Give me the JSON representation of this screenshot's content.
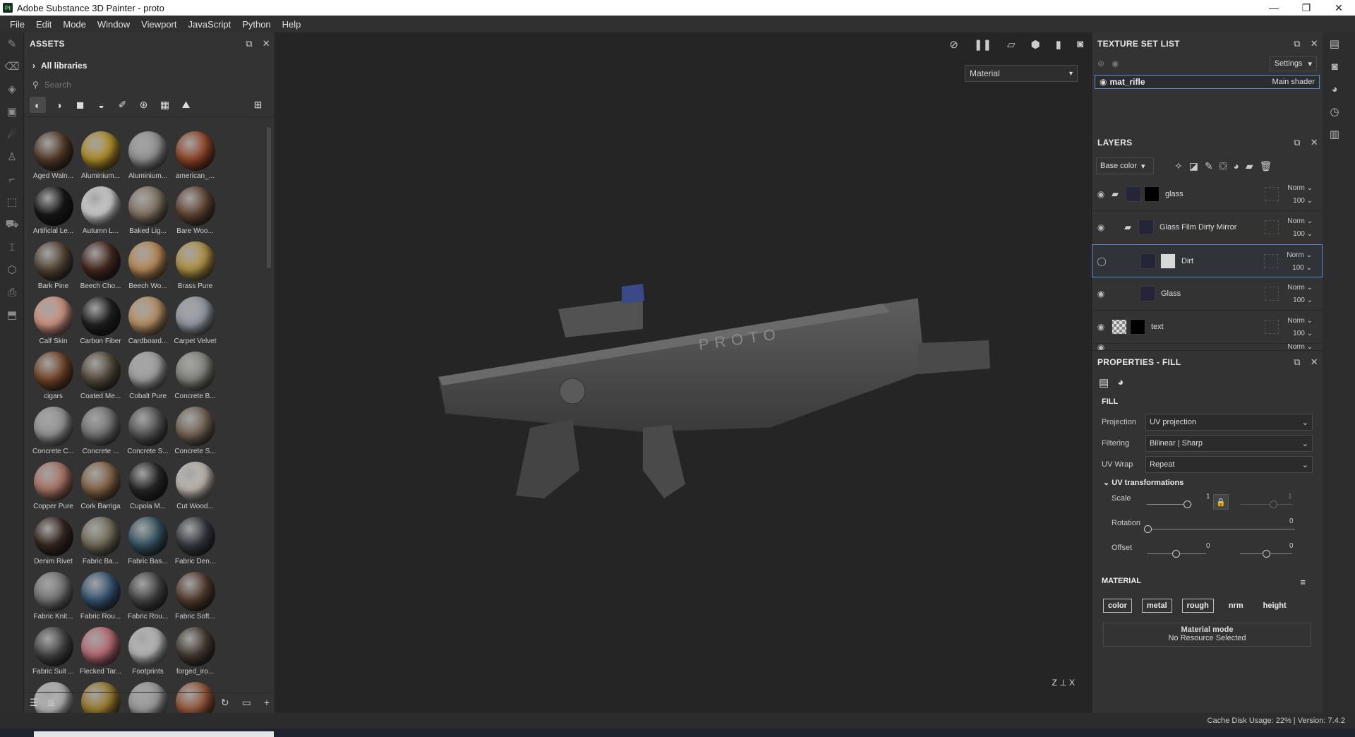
{
  "window": {
    "title": "Adobe Substance 3D Painter - proto",
    "app_icon": "Pt",
    "controls": [
      "—",
      "❐",
      "✕"
    ]
  },
  "menu": [
    "File",
    "Edit",
    "Mode",
    "Window",
    "Viewport",
    "JavaScript",
    "Python",
    "Help"
  ],
  "assets": {
    "title": "ASSETS",
    "library": "All libraries",
    "search_placeholder": "Search",
    "items": [
      {
        "label": "Aged Waln...",
        "color": "#5a3f2c"
      },
      {
        "label": "Aluminium...",
        "color": "#b8942c"
      },
      {
        "label": "Aluminium...",
        "color": "#9a9a9a"
      },
      {
        "label": "american_...",
        "color": "#9a4a2c"
      },
      {
        "label": "Artificial Le...",
        "color": "#1a1a1a"
      },
      {
        "label": "Autumn L...",
        "color": "#d8d8d8"
      },
      {
        "label": "Baked Lig...",
        "color": "#8a7a68"
      },
      {
        "label": "Bare Woo...",
        "color": "#6a4a38"
      },
      {
        "label": "Bark Pine",
        "color": "#5a4a3a"
      },
      {
        "label": "Beech Cho...",
        "color": "#4a2c22"
      },
      {
        "label": "Beech Wo...",
        "color": "#c0905a"
      },
      {
        "label": "Brass Pure",
        "color": "#b89a48"
      },
      {
        "label": "Calf Skin",
        "color": "#d89a88"
      },
      {
        "label": "Carbon Fiber",
        "color": "#222222"
      },
      {
        "label": "Cardboard...",
        "color": "#c0986a"
      },
      {
        "label": "Carpet Velvet",
        "color": "#9aa0aa"
      },
      {
        "label": "cigars",
        "color": "#7a4a2c"
      },
      {
        "label": "Coated Me...",
        "color": "#5a5040"
      },
      {
        "label": "Cobalt Pure",
        "color": "#a8a8a8"
      },
      {
        "label": "Concrete B...",
        "color": "#8a8a82"
      },
      {
        "label": "Concrete C...",
        "color": "#9a9a9a"
      },
      {
        "label": "Concrete ...",
        "color": "#7a7a7a"
      },
      {
        "label": "Concrete S...",
        "color": "#5a5a5a"
      },
      {
        "label": "Concrete S...",
        "color": "#7a6a5a"
      },
      {
        "label": "Copper Pure",
        "color": "#b07a6a"
      },
      {
        "label": "Cork Barriga",
        "color": "#8a6a4a"
      },
      {
        "label": "Cupola M...",
        "color": "#2a2a2a"
      },
      {
        "label": "Cut Wood...",
        "color": "#c8c0b8"
      },
      {
        "label": "Denim Rivet",
        "color": "#3a2a22"
      },
      {
        "label": "Fabric Ba...",
        "color": "#7a7260"
      },
      {
        "label": "Fabric Bas...",
        "color": "#3a5a6a"
      },
      {
        "label": "Fabric Den...",
        "color": "#3a3e44"
      },
      {
        "label": "Fabric Knit...",
        "color": "#7a7a7a"
      },
      {
        "label": "Fabric Rou...",
        "color": "#3a5a7a"
      },
      {
        "label": "Fabric Rou...",
        "color": "#4a4a4a"
      },
      {
        "label": "Fabric Soft...",
        "color": "#5a4034"
      },
      {
        "label": "Fabric Suit ...",
        "color": "#4a4a4a"
      },
      {
        "label": "Flecked Tar...",
        "color": "#c0707a"
      },
      {
        "label": "Footprints",
        "color": "#c0c0c0"
      },
      {
        "label": "forged_iro...",
        "color": "#4a4036"
      },
      {
        "label": "",
        "color": "#bbbbbb"
      },
      {
        "label": "",
        "color": "#a08030"
      },
      {
        "label": "",
        "color": "#a0a0a0"
      },
      {
        "label": "",
        "color": "#9a5a3a"
      }
    ]
  },
  "viewport": {
    "display_mode": "Material",
    "axis_label": "Z ⊥ X"
  },
  "texture_set_list": {
    "title": "TEXTURE SET LIST",
    "settings_label": "Settings",
    "item": {
      "name": "mat_rifle",
      "shader": "Main shader"
    }
  },
  "layers": {
    "title": "LAYERS",
    "channel": "Base color",
    "items": [
      {
        "name": "glass",
        "blend": "Norm",
        "opacity": "100"
      },
      {
        "name": "Glass Film Dirty Mirror",
        "blend": "Norm",
        "opacity": "100"
      },
      {
        "name": "Dirt",
        "blend": "Norm",
        "opacity": "100"
      },
      {
        "name": "Glass",
        "blend": "Norm",
        "opacity": "100"
      },
      {
        "name": "text",
        "blend": "Norm",
        "opacity": "100"
      },
      {
        "name": "",
        "blend": "Norm",
        "opacity": ""
      }
    ]
  },
  "properties": {
    "title": "PROPERTIES - FILL",
    "fill_title": "FILL",
    "projection_label": "Projection",
    "projection_value": "UV projection",
    "filtering_label": "Filtering",
    "filtering_value": "Bilinear | Sharp",
    "uvwrap_label": "UV Wrap",
    "uvwrap_value": "Repeat",
    "uv_transform_title": "UV transformations",
    "scale_label": "Scale",
    "scale_value": "1",
    "scale_value_locked": "1",
    "rotation_label": "Rotation",
    "rotation_value": "0",
    "offset_label": "Offset",
    "offset_u": "0",
    "offset_v": "0",
    "material_title": "MATERIAL",
    "channels": [
      "color",
      "metal",
      "rough",
      "nrm",
      "height"
    ],
    "material_mode_label": "Material mode",
    "material_mode_value": "No Resource Selected"
  },
  "status": {
    "text": "Cache Disk Usage:   22% | Version: 7.4.2"
  }
}
